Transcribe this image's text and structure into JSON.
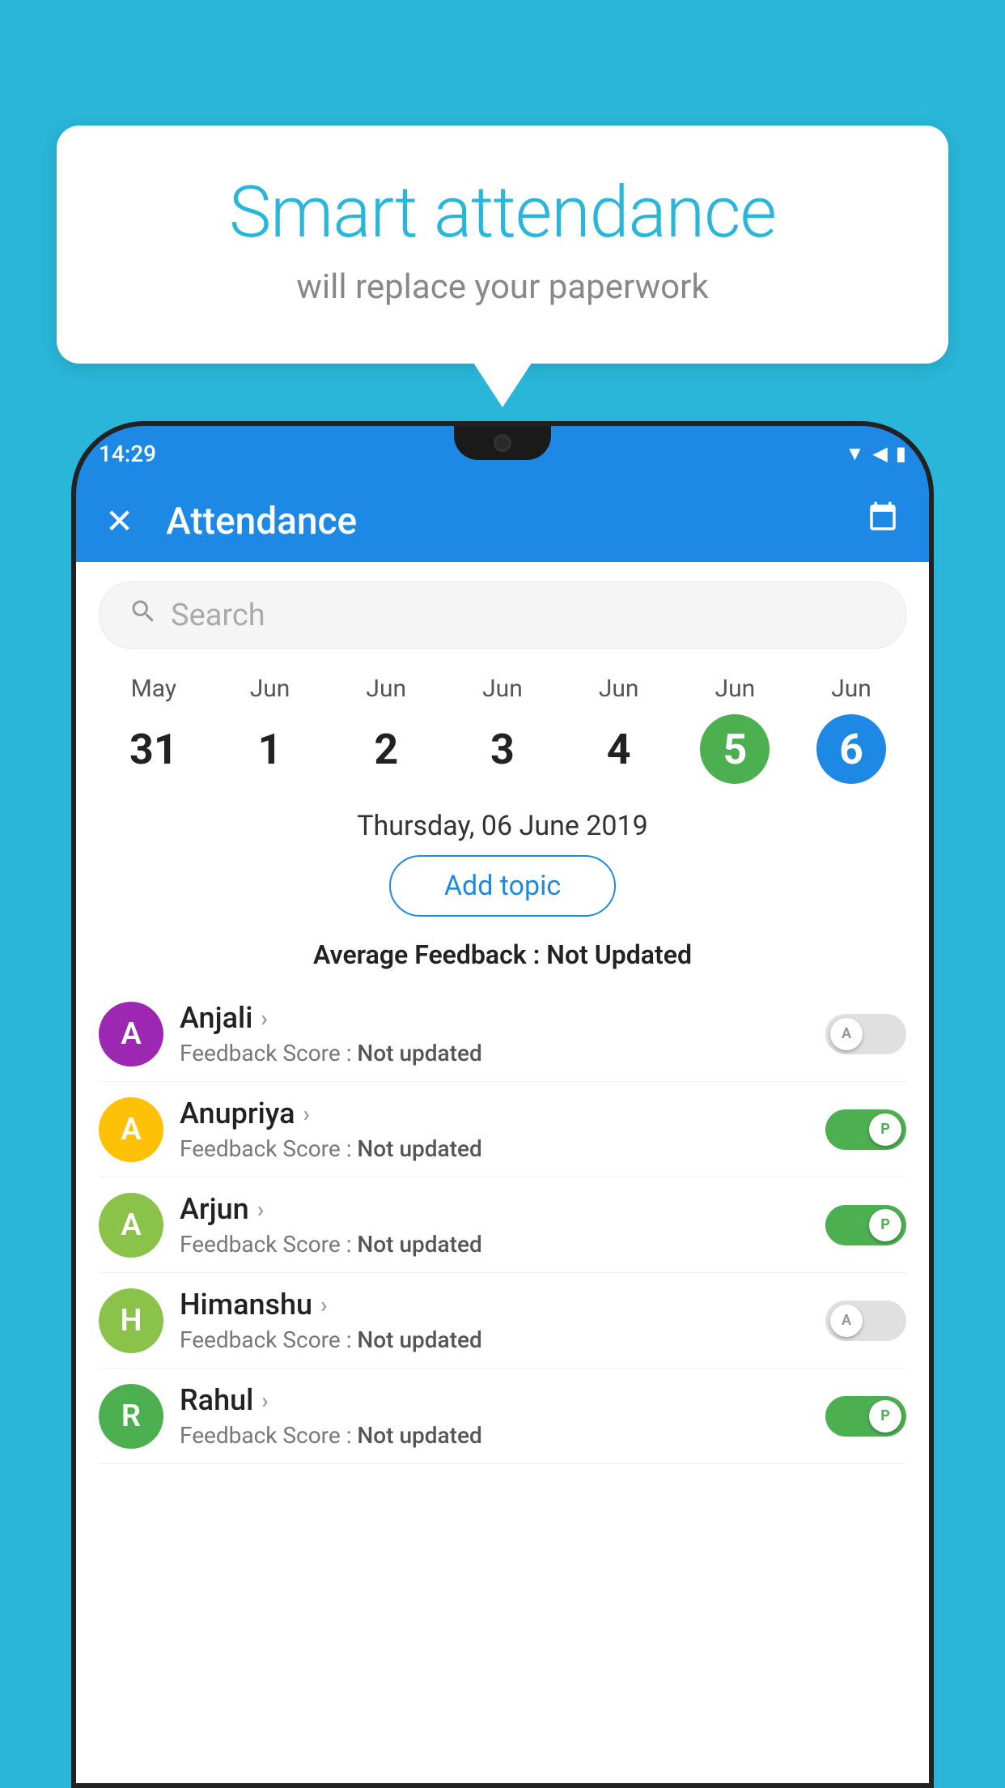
{
  "background_color": "#29B6D8",
  "bubble": {
    "title": "Smart attendance",
    "subtitle": "will replace your paperwork"
  },
  "status_bar": {
    "time": "14:29",
    "icons": [
      "wifi",
      "signal",
      "battery"
    ]
  },
  "header": {
    "close_icon": "✕",
    "title": "Attendance",
    "calendar_icon": "📅"
  },
  "search": {
    "placeholder": "Search"
  },
  "calendar": {
    "days": [
      {
        "month": "May",
        "date": "31",
        "style": "normal"
      },
      {
        "month": "Jun",
        "date": "1",
        "style": "normal"
      },
      {
        "month": "Jun",
        "date": "2",
        "style": "normal"
      },
      {
        "month": "Jun",
        "date": "3",
        "style": "normal"
      },
      {
        "month": "Jun",
        "date": "4",
        "style": "normal"
      },
      {
        "month": "Jun",
        "date": "5",
        "style": "today-green"
      },
      {
        "month": "Jun",
        "date": "6",
        "style": "selected-blue"
      }
    ]
  },
  "selected_date_label": "Thursday, 06 June 2019",
  "add_topic_label": "Add topic",
  "avg_feedback": {
    "label": "Average Feedback :",
    "value": "Not Updated"
  },
  "students": [
    {
      "name": "Anjali",
      "avatar_letter": "A",
      "avatar_color": "#9c27b0",
      "feedback_label": "Feedback Score :",
      "feedback_value": "Not updated",
      "toggle": "off",
      "toggle_letter": "A"
    },
    {
      "name": "Anupriya",
      "avatar_letter": "A",
      "avatar_color": "#ffc107",
      "feedback_label": "Feedback Score :",
      "feedback_value": "Not updated",
      "toggle": "on",
      "toggle_letter": "P"
    },
    {
      "name": "Arjun",
      "avatar_letter": "A",
      "avatar_color": "#8bc34a",
      "feedback_label": "Feedback Score :",
      "feedback_value": "Not updated",
      "toggle": "on",
      "toggle_letter": "P"
    },
    {
      "name": "Himanshu",
      "avatar_letter": "H",
      "avatar_color": "#8bc34a",
      "feedback_label": "Feedback Score :",
      "feedback_value": "Not updated",
      "toggle": "off",
      "toggle_letter": "A"
    },
    {
      "name": "Rahul",
      "avatar_letter": "R",
      "avatar_color": "#4caf50",
      "feedback_label": "Feedback Score :",
      "feedback_value": "Not updated",
      "toggle": "on",
      "toggle_letter": "P"
    }
  ]
}
